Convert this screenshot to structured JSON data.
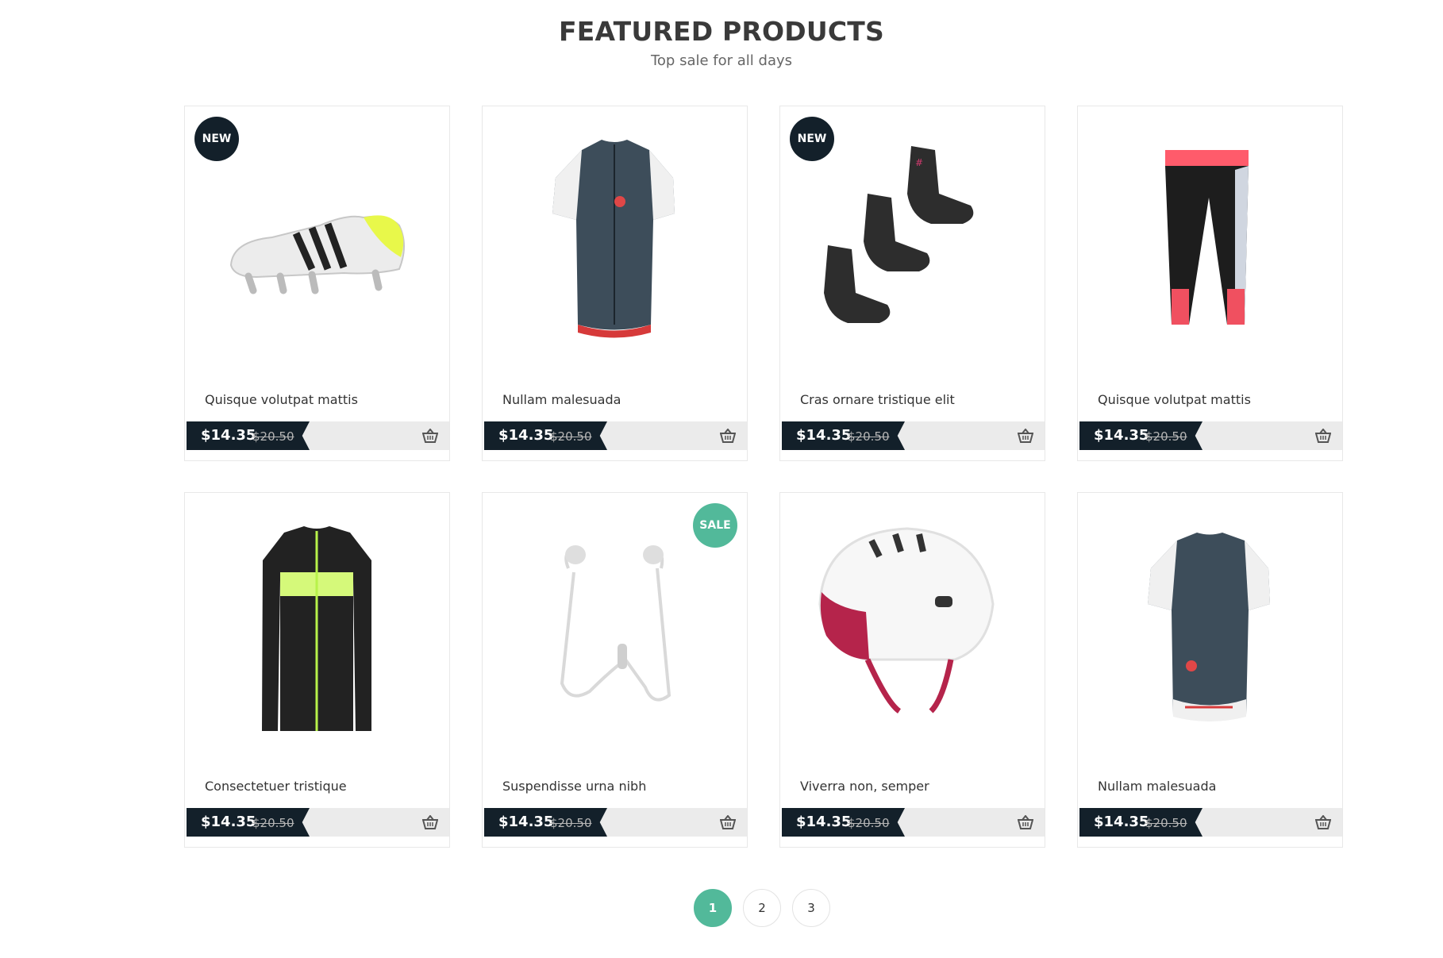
{
  "header": {
    "title": "FEATURED PRODUCTS",
    "subtitle": "Top sale for all days"
  },
  "products": [
    {
      "name": "Quisque volutpat mattis",
      "price": "$14.35",
      "old_price": "$20.50",
      "badge": "NEW",
      "image": "soccer-cleat"
    },
    {
      "name": "Nullam malesuada",
      "price": "$14.35",
      "old_price": "$20.50",
      "badge": "",
      "image": "cycling-jersey-front"
    },
    {
      "name": "Cras ornare tristique elit",
      "price": "$14.35",
      "old_price": "$20.50",
      "badge": "NEW",
      "image": "socks"
    },
    {
      "name": "Quisque volutpat mattis",
      "price": "$14.35",
      "old_price": "$20.50",
      "badge": "",
      "image": "leggings"
    },
    {
      "name": "Consectetuer tristique",
      "price": "$14.35",
      "old_price": "$20.50",
      "badge": "",
      "image": "long-sleeve-jersey"
    },
    {
      "name": "Suspendisse urna nibh",
      "price": "$14.35",
      "old_price": "$20.50",
      "badge": "SALE",
      "image": "earphones"
    },
    {
      "name": "Viverra non, semper",
      "price": "$14.35",
      "old_price": "$20.50",
      "badge": "",
      "image": "helmet"
    },
    {
      "name": "Nullam malesuada",
      "price": "$14.35",
      "old_price": "$20.50",
      "badge": "",
      "image": "cycling-jersey-back"
    }
  ],
  "pagination": {
    "pages": [
      "1",
      "2",
      "3"
    ],
    "current": "1"
  },
  "colors": {
    "accent": "#52b99a",
    "dark": "#13202a",
    "price_bar": "#ebebeb"
  },
  "icons": {
    "cart": "basket-icon"
  }
}
